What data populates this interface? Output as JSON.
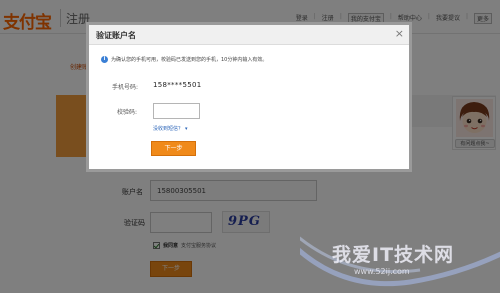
{
  "header": {
    "logo_text": "支付宝",
    "page_name": "注册",
    "nav": [
      "登录",
      "注册",
      "我的支付宝",
      "帮助中心",
      "我要提议",
      "更多"
    ]
  },
  "steps": {
    "current_label": "创建账户"
  },
  "form": {
    "account_label": "账户名",
    "account_value": "15800305501",
    "code_label": "验证码",
    "captcha_text": "9PG",
    "agree_prefix": "我同意",
    "agree_link": "支付宝服务协议",
    "next_label": "下一步"
  },
  "avatar": {
    "caption": "有问题点我~"
  },
  "modal": {
    "title": "验证账户名",
    "close_glyph": "×",
    "notice": "为确认您的手机可用，校验码已发送到您的手机，10分钟内输入有效。",
    "phone_label": "手机号码:",
    "phone_value": "158****5501",
    "verify_label": "校验码:",
    "verify_value": "",
    "resend_label": "没收到短信？",
    "resend_arrow": "▾",
    "next_label": "下一步"
  },
  "watermark": {
    "text": "我爱IT技术网",
    "url": "www.52ij.com"
  },
  "colors": {
    "accent_orange": "#f08a1a",
    "link_blue": "#2a64b8",
    "info_blue": "#3a7fd5"
  },
  "icons": [
    "info-icon",
    "close-icon",
    "checkbox-icon",
    "chevron-down-icon"
  ]
}
